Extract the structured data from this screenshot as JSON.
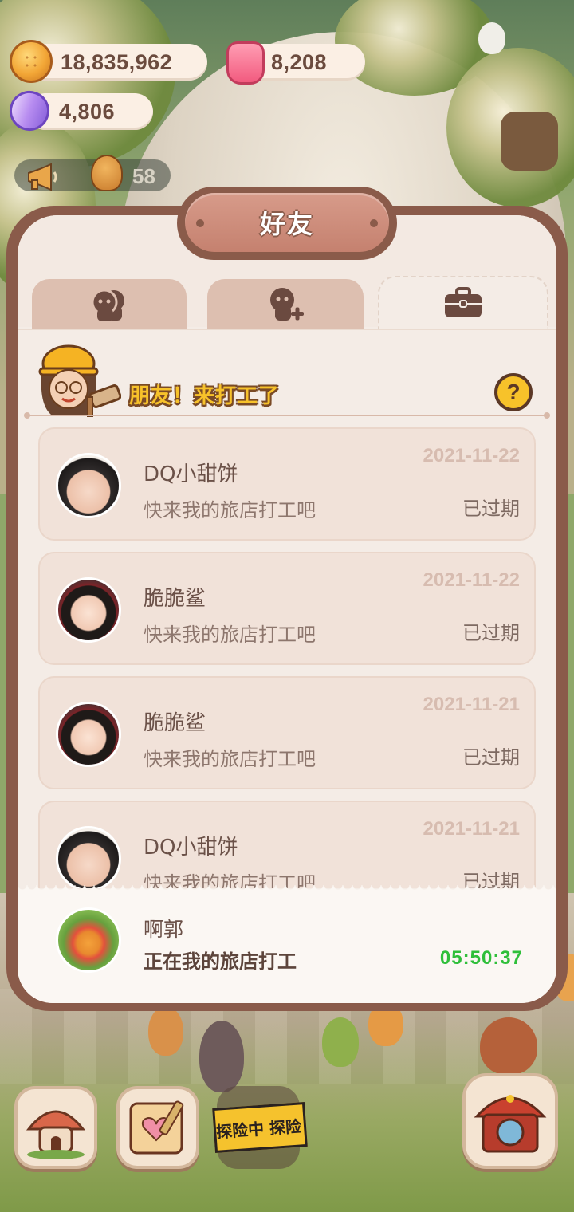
{
  "currencies": {
    "coins": "18,835,962",
    "jelly": "8,208",
    "crystals": "4,806"
  },
  "notification": {
    "count": "58"
  },
  "dialog": {
    "title": "好友",
    "tabs": [
      {
        "icon": "friends-icon",
        "active": false
      },
      {
        "icon": "add-friend-icon",
        "active": false
      },
      {
        "icon": "briefcase-icon",
        "active": true
      }
    ],
    "banner": "朋友！来打工了",
    "help_label": "?"
  },
  "invites": [
    {
      "name": "DQ小甜饼",
      "message": "快来我的旅店打工吧",
      "date": "2021-11-22",
      "status": "已过期",
      "avatar": "av-a"
    },
    {
      "name": "脆脆鲨",
      "message": "快来我的旅店打工吧",
      "date": "2021-11-22",
      "status": "已过期",
      "avatar": "av-b"
    },
    {
      "name": "脆脆鲨",
      "message": "快来我的旅店打工吧",
      "date": "2021-11-21",
      "status": "已过期",
      "avatar": "av-b"
    },
    {
      "name": "DQ小甜饼",
      "message": "快来我的旅店打工吧",
      "date": "2021-11-21",
      "status": "已过期",
      "avatar": "av-a"
    }
  ],
  "active_worker": {
    "name": "啊郭",
    "message": "正在我的旅店打工",
    "timer": "05:50:37"
  },
  "bottom_nav": {
    "explore_label": "探险中 探险"
  },
  "colors": {
    "dialog_frame": "#8a5b4a",
    "dialog_bg": "#f4ece6",
    "card_bg": "#f1e2d9",
    "timer_green": "#2fbf3a",
    "banner_yellow": "#f7c22a"
  }
}
